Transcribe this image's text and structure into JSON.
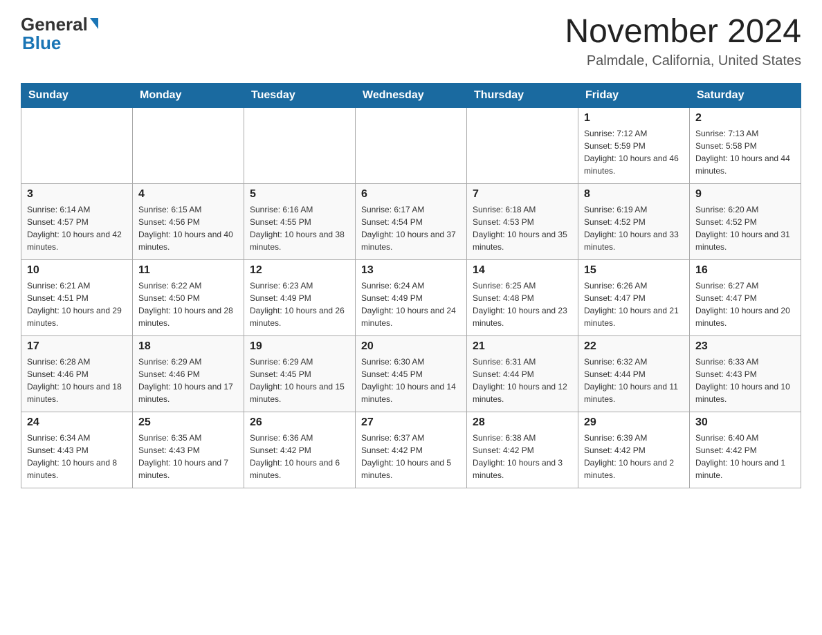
{
  "header": {
    "logo_general": "General",
    "logo_blue": "Blue",
    "month_title": "November 2024",
    "location": "Palmdale, California, United States"
  },
  "weekdays": [
    "Sunday",
    "Monday",
    "Tuesday",
    "Wednesday",
    "Thursday",
    "Friday",
    "Saturday"
  ],
  "weeks": [
    [
      {
        "day": "",
        "info": ""
      },
      {
        "day": "",
        "info": ""
      },
      {
        "day": "",
        "info": ""
      },
      {
        "day": "",
        "info": ""
      },
      {
        "day": "",
        "info": ""
      },
      {
        "day": "1",
        "info": "Sunrise: 7:12 AM\nSunset: 5:59 PM\nDaylight: 10 hours and 46 minutes."
      },
      {
        "day": "2",
        "info": "Sunrise: 7:13 AM\nSunset: 5:58 PM\nDaylight: 10 hours and 44 minutes."
      }
    ],
    [
      {
        "day": "3",
        "info": "Sunrise: 6:14 AM\nSunset: 4:57 PM\nDaylight: 10 hours and 42 minutes."
      },
      {
        "day": "4",
        "info": "Sunrise: 6:15 AM\nSunset: 4:56 PM\nDaylight: 10 hours and 40 minutes."
      },
      {
        "day": "5",
        "info": "Sunrise: 6:16 AM\nSunset: 4:55 PM\nDaylight: 10 hours and 38 minutes."
      },
      {
        "day": "6",
        "info": "Sunrise: 6:17 AM\nSunset: 4:54 PM\nDaylight: 10 hours and 37 minutes."
      },
      {
        "day": "7",
        "info": "Sunrise: 6:18 AM\nSunset: 4:53 PM\nDaylight: 10 hours and 35 minutes."
      },
      {
        "day": "8",
        "info": "Sunrise: 6:19 AM\nSunset: 4:52 PM\nDaylight: 10 hours and 33 minutes."
      },
      {
        "day": "9",
        "info": "Sunrise: 6:20 AM\nSunset: 4:52 PM\nDaylight: 10 hours and 31 minutes."
      }
    ],
    [
      {
        "day": "10",
        "info": "Sunrise: 6:21 AM\nSunset: 4:51 PM\nDaylight: 10 hours and 29 minutes."
      },
      {
        "day": "11",
        "info": "Sunrise: 6:22 AM\nSunset: 4:50 PM\nDaylight: 10 hours and 28 minutes."
      },
      {
        "day": "12",
        "info": "Sunrise: 6:23 AM\nSunset: 4:49 PM\nDaylight: 10 hours and 26 minutes."
      },
      {
        "day": "13",
        "info": "Sunrise: 6:24 AM\nSunset: 4:49 PM\nDaylight: 10 hours and 24 minutes."
      },
      {
        "day": "14",
        "info": "Sunrise: 6:25 AM\nSunset: 4:48 PM\nDaylight: 10 hours and 23 minutes."
      },
      {
        "day": "15",
        "info": "Sunrise: 6:26 AM\nSunset: 4:47 PM\nDaylight: 10 hours and 21 minutes."
      },
      {
        "day": "16",
        "info": "Sunrise: 6:27 AM\nSunset: 4:47 PM\nDaylight: 10 hours and 20 minutes."
      }
    ],
    [
      {
        "day": "17",
        "info": "Sunrise: 6:28 AM\nSunset: 4:46 PM\nDaylight: 10 hours and 18 minutes."
      },
      {
        "day": "18",
        "info": "Sunrise: 6:29 AM\nSunset: 4:46 PM\nDaylight: 10 hours and 17 minutes."
      },
      {
        "day": "19",
        "info": "Sunrise: 6:29 AM\nSunset: 4:45 PM\nDaylight: 10 hours and 15 minutes."
      },
      {
        "day": "20",
        "info": "Sunrise: 6:30 AM\nSunset: 4:45 PM\nDaylight: 10 hours and 14 minutes."
      },
      {
        "day": "21",
        "info": "Sunrise: 6:31 AM\nSunset: 4:44 PM\nDaylight: 10 hours and 12 minutes."
      },
      {
        "day": "22",
        "info": "Sunrise: 6:32 AM\nSunset: 4:44 PM\nDaylight: 10 hours and 11 minutes."
      },
      {
        "day": "23",
        "info": "Sunrise: 6:33 AM\nSunset: 4:43 PM\nDaylight: 10 hours and 10 minutes."
      }
    ],
    [
      {
        "day": "24",
        "info": "Sunrise: 6:34 AM\nSunset: 4:43 PM\nDaylight: 10 hours and 8 minutes."
      },
      {
        "day": "25",
        "info": "Sunrise: 6:35 AM\nSunset: 4:43 PM\nDaylight: 10 hours and 7 minutes."
      },
      {
        "day": "26",
        "info": "Sunrise: 6:36 AM\nSunset: 4:42 PM\nDaylight: 10 hours and 6 minutes."
      },
      {
        "day": "27",
        "info": "Sunrise: 6:37 AM\nSunset: 4:42 PM\nDaylight: 10 hours and 5 minutes."
      },
      {
        "day": "28",
        "info": "Sunrise: 6:38 AM\nSunset: 4:42 PM\nDaylight: 10 hours and 3 minutes."
      },
      {
        "day": "29",
        "info": "Sunrise: 6:39 AM\nSunset: 4:42 PM\nDaylight: 10 hours and 2 minutes."
      },
      {
        "day": "30",
        "info": "Sunrise: 6:40 AM\nSunset: 4:42 PM\nDaylight: 10 hours and 1 minute."
      }
    ]
  ]
}
